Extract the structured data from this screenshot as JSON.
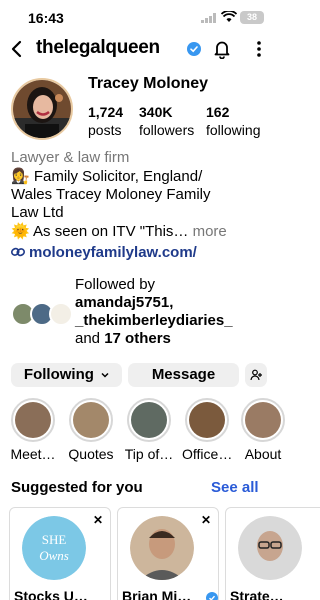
{
  "status_bar": {
    "time": "16:43",
    "battery": "38"
  },
  "header": {
    "username": "thelegalqueen"
  },
  "profile": {
    "name": "Tracey Moloney",
    "stats": [
      {
        "value": "1,724",
        "label": "posts"
      },
      {
        "value": "340K",
        "label": "followers"
      },
      {
        "value": "162",
        "label": "following"
      }
    ],
    "category": "Lawyer & law firm",
    "bio_line1": "👩‍⚖️ Family Solicitor, England/",
    "bio_line2": "Wales Tracey Moloney Family",
    "bio_line3": "Law Ltd",
    "bio_line4": "🌞 As seen on ITV \"This…",
    "bio_more": " more",
    "link": "moloneyfamilylaw.com/"
  },
  "followed_by": {
    "prefix": "Followed by",
    "user1": "amandaj5751,",
    "user2": "_thekimberleydiaries_",
    "and_text": "and ",
    "others": "17 others"
  },
  "buttons": {
    "following": "Following",
    "message": "Message"
  },
  "highlights": [
    {
      "label": "Meet…",
      "color": "#8a6e58"
    },
    {
      "label": "Quotes",
      "color": "#a3886a"
    },
    {
      "label": "Tip of…",
      "color": "#5f6a62"
    },
    {
      "label": "Office…",
      "color": "#7b5a3d"
    },
    {
      "label": "About",
      "color": "#9a7b64"
    }
  ],
  "suggested": {
    "title": "Suggested for you",
    "see_all": "See all",
    "cards": [
      {
        "name": "Stocks U…",
        "logo_text": "SHE",
        "logo_sub": "Owns"
      },
      {
        "name": "Brian Mi…"
      },
      {
        "name": "Strate…"
      }
    ]
  },
  "colors": {
    "accent": "#2a5bd7",
    "verified": "#3897f0",
    "link": "#1f3a8a"
  }
}
